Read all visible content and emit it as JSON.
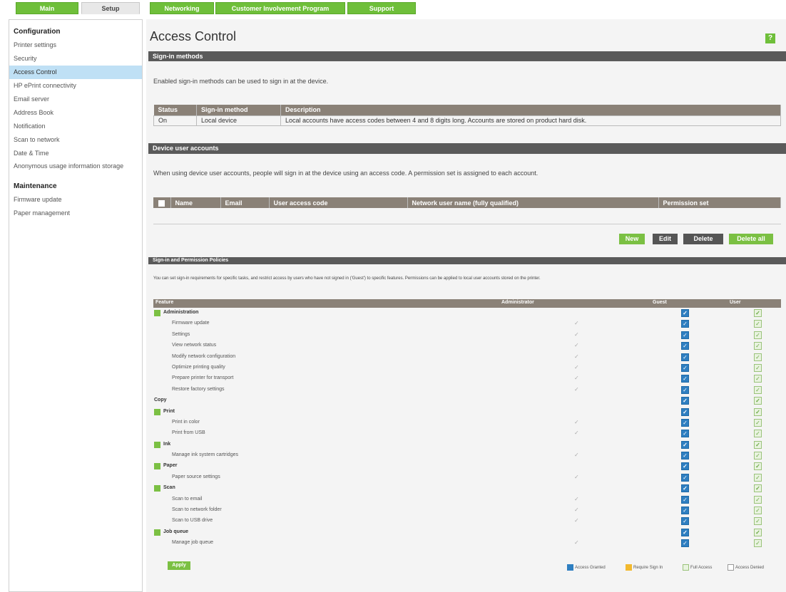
{
  "tabs": {
    "main": "Main",
    "setup": "Setup",
    "networking": "Networking",
    "customer": "Customer Involvement Program",
    "support": "Support"
  },
  "sidebar": {
    "configuration_heading": "Configuration",
    "config_items": [
      "Printer settings",
      "Security",
      "Access Control",
      "HP ePrint connectivity",
      "Email server",
      "Address Book",
      "Notification",
      "Scan to network",
      "Date & Time",
      "Anonymous usage information storage"
    ],
    "maintenance_heading": "Maintenance",
    "maintenance_items": [
      "Firmware update",
      "Paper management"
    ]
  },
  "main": {
    "title": "Access Control",
    "help_label": "?",
    "signin": {
      "heading": "Sign-in methods",
      "desc": "Enabled sign-in methods can be used to sign in at the device.",
      "columns": [
        "Status",
        "Sign-in method",
        "Description"
      ],
      "row": {
        "status": "On",
        "method": "Local device",
        "description": "Local accounts have access codes between 4 and 8 digits long. Accounts are stored on product hard disk."
      }
    },
    "accounts": {
      "heading": "Device user accounts",
      "desc": "When using device user accounts, people will sign in at the device using an access code. A permission set is assigned to each account.",
      "columns": [
        "Name",
        "Email",
        "User access code",
        "Network user name (fully qualified)",
        "Permission set"
      ],
      "buttons": {
        "new": "New",
        "edit": "Edit",
        "delete": "Delete",
        "delete_all": "Delete all"
      }
    },
    "policies": {
      "heading": "Sign-in and Permission Policies",
      "desc": "You can set sign-in requirements for specific tasks, and restrict access by users who have not signed in ('Guest') to specific features. Permissions can be applied to local user accounts stored on the printer.",
      "columns": [
        "Feature",
        "Administrator",
        "Guest",
        "User"
      ],
      "rows": [
        {
          "label": "Administration",
          "group": true
        },
        {
          "label": "Firmware update"
        },
        {
          "label": "Settings"
        },
        {
          "label": "View network status"
        },
        {
          "label": "Modify network configuration"
        },
        {
          "label": "Optimize printing quality"
        },
        {
          "label": "Prepare printer for transport"
        },
        {
          "label": "Restore factory settings"
        },
        {
          "label": "Copy",
          "group": true,
          "nosq": true
        },
        {
          "label": "Print",
          "group": true
        },
        {
          "label": "Print in color"
        },
        {
          "label": "Print from USB"
        },
        {
          "label": "Ink",
          "group": true
        },
        {
          "label": "Manage ink system cartridges"
        },
        {
          "label": "Paper",
          "group": true
        },
        {
          "label": "Paper source settings"
        },
        {
          "label": "Scan",
          "group": true
        },
        {
          "label": "Scan to email"
        },
        {
          "label": "Scan to network folder"
        },
        {
          "label": "Scan to USB drive"
        },
        {
          "label": "Job queue",
          "group": true
        },
        {
          "label": "Manage job queue"
        }
      ],
      "apply": "Apply",
      "legend": [
        "Access Granted",
        "Require Sign In",
        "Full Access",
        "Access Denied"
      ]
    }
  }
}
